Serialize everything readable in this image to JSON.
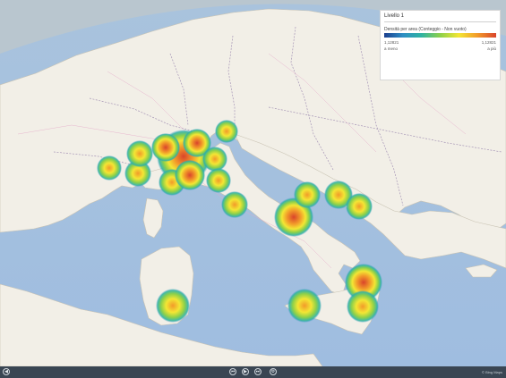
{
  "legend": {
    "title": "Livello 1",
    "subtitle": "Densità per area (Conteggio - Non vuoto)",
    "min_value": "1,12821",
    "max_value": "1,12821",
    "min_text": "a meno",
    "max_text": "a più",
    "ramp_colors": [
      "#1b3f8f",
      "#2d8ec4",
      "#2fb3a2",
      "#8cd04a",
      "#f3e634",
      "#f29a2a",
      "#d9442b"
    ]
  },
  "map_labels": {
    "credit": "© Bing Maps"
  },
  "heat_spots": [
    {
      "region": "Piemonte",
      "intensity": 0.45
    },
    {
      "region": "Lombardia",
      "intensity": 0.95
    },
    {
      "region": "Veneto",
      "intensity": 0.55
    },
    {
      "region": "Friuli Venezia Giulia",
      "intensity": 0.4
    },
    {
      "region": "Liguria",
      "intensity": 0.45
    },
    {
      "region": "Emilia-Romagna",
      "intensity": 0.75
    },
    {
      "region": "Toscana",
      "intensity": 0.55
    },
    {
      "region": "Marche",
      "intensity": 0.45
    },
    {
      "region": "Lazio",
      "intensity": 0.45
    },
    {
      "region": "Campania",
      "intensity": 0.85
    },
    {
      "region": "Puglia Nord",
      "intensity": 0.45
    },
    {
      "region": "Puglia Bari",
      "intensity": 0.5
    },
    {
      "region": "Puglia Sud",
      "intensity": 0.45
    },
    {
      "region": "Sardegna",
      "intensity": 0.6
    },
    {
      "region": "Sicilia Ovest",
      "intensity": 0.6
    },
    {
      "region": "Calabria",
      "intensity": 0.9
    },
    {
      "region": "Sicilia Est",
      "intensity": 0.6
    }
  ],
  "toolbar": {
    "buttons": [
      "back-icon",
      "previous-icon",
      "play-icon",
      "next-icon",
      "settings-icon"
    ]
  }
}
